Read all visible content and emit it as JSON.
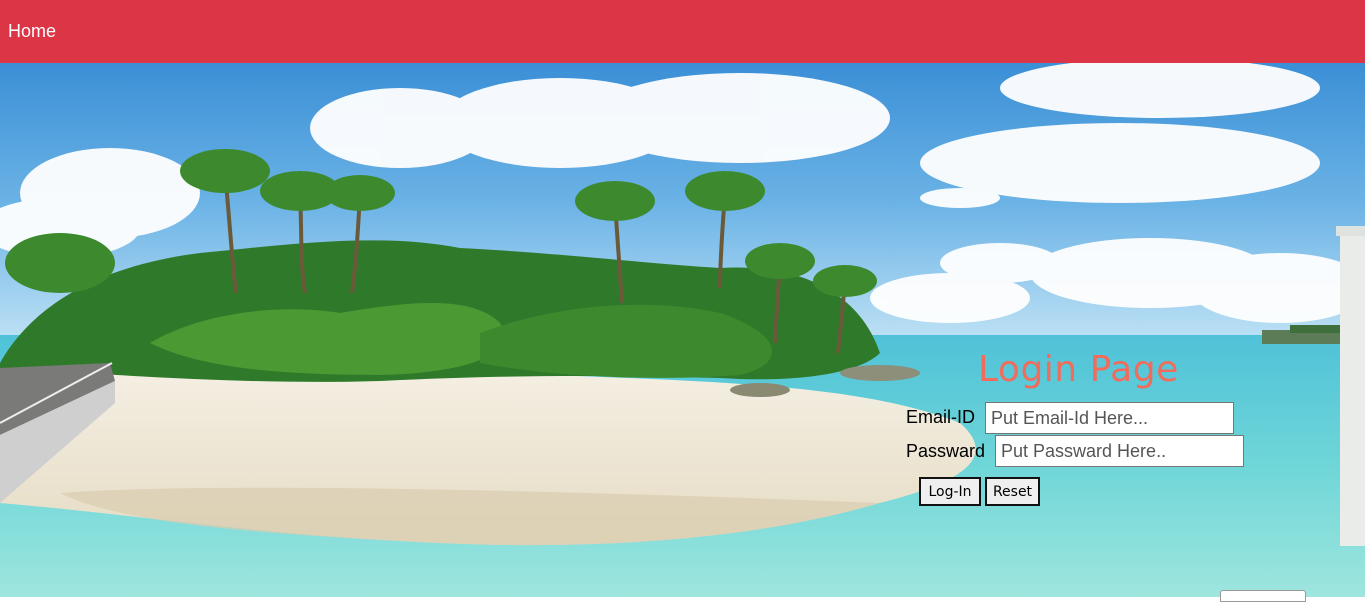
{
  "nav": {
    "home_label": "Home",
    "bar_color": "#dc3545"
  },
  "background": {
    "description_icon": "beach-scene-image"
  },
  "login": {
    "title": "Login Page",
    "title_color": "#f26b5b",
    "email_label": "Email-ID",
    "email_placeholder": "Put Email-Id Here...",
    "email_value": "",
    "password_label": "Passward",
    "password_placeholder": "Put Passward Here..",
    "password_value": "",
    "login_button": "Log-In",
    "reset_button": "Reset"
  },
  "corner_widget": {
    "label": ""
  }
}
